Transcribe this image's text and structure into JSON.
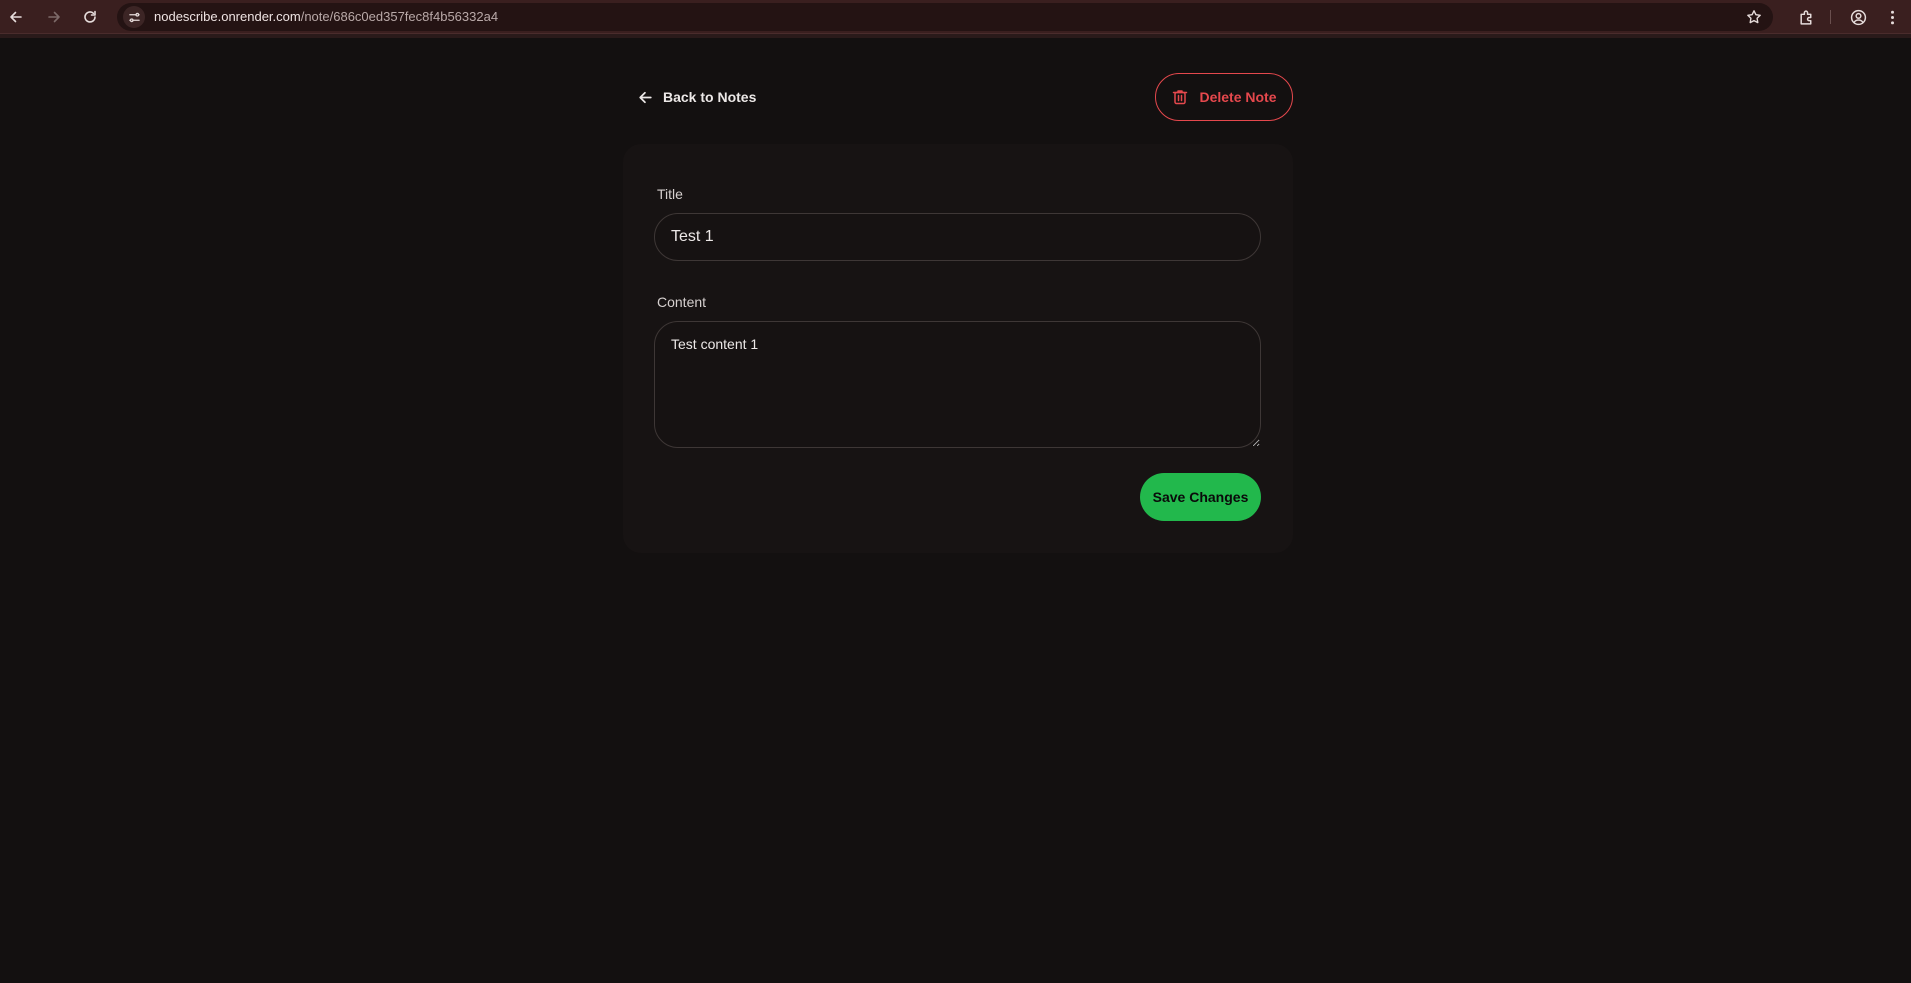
{
  "browser": {
    "url_host": "nodescribe.onrender.com",
    "url_path": "/note/686c0ed357fec8f4b56332a4",
    "icons": [
      "back-arrow-icon",
      "forward-arrow-icon",
      "reload-icon",
      "site-info-icon",
      "bookmark-star-icon",
      "extensions-icon",
      "profile-icon",
      "kebab-menu-icon"
    ],
    "page_load_progress": 0.0
  },
  "header": {
    "back_label": "Back to Notes",
    "delete_label": "Delete Note",
    "delete_color": "#e5484d"
  },
  "form": {
    "title_label": "Title",
    "title_value": "Test 1",
    "content_label": "Content",
    "content_value": "Test content 1",
    "save_label": "Save Changes",
    "save_color": "#22b84c"
  }
}
